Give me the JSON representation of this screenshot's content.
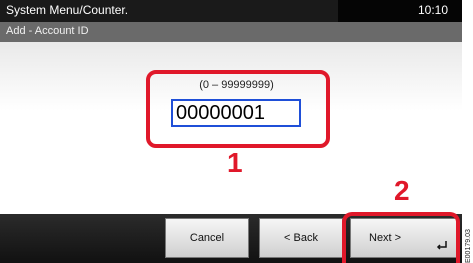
{
  "header": {
    "title": "System Menu/Counter.",
    "time": "10:10"
  },
  "subheader": {
    "title": "Add - Account ID"
  },
  "account_id": {
    "range_label": "(0 – 99999999)",
    "value": "00000001"
  },
  "callouts": {
    "step1": "1",
    "step2": "2"
  },
  "buttons": {
    "cancel": "Cancel",
    "back": "< Back",
    "next": "Next >"
  },
  "side_code": "E00179.03"
}
